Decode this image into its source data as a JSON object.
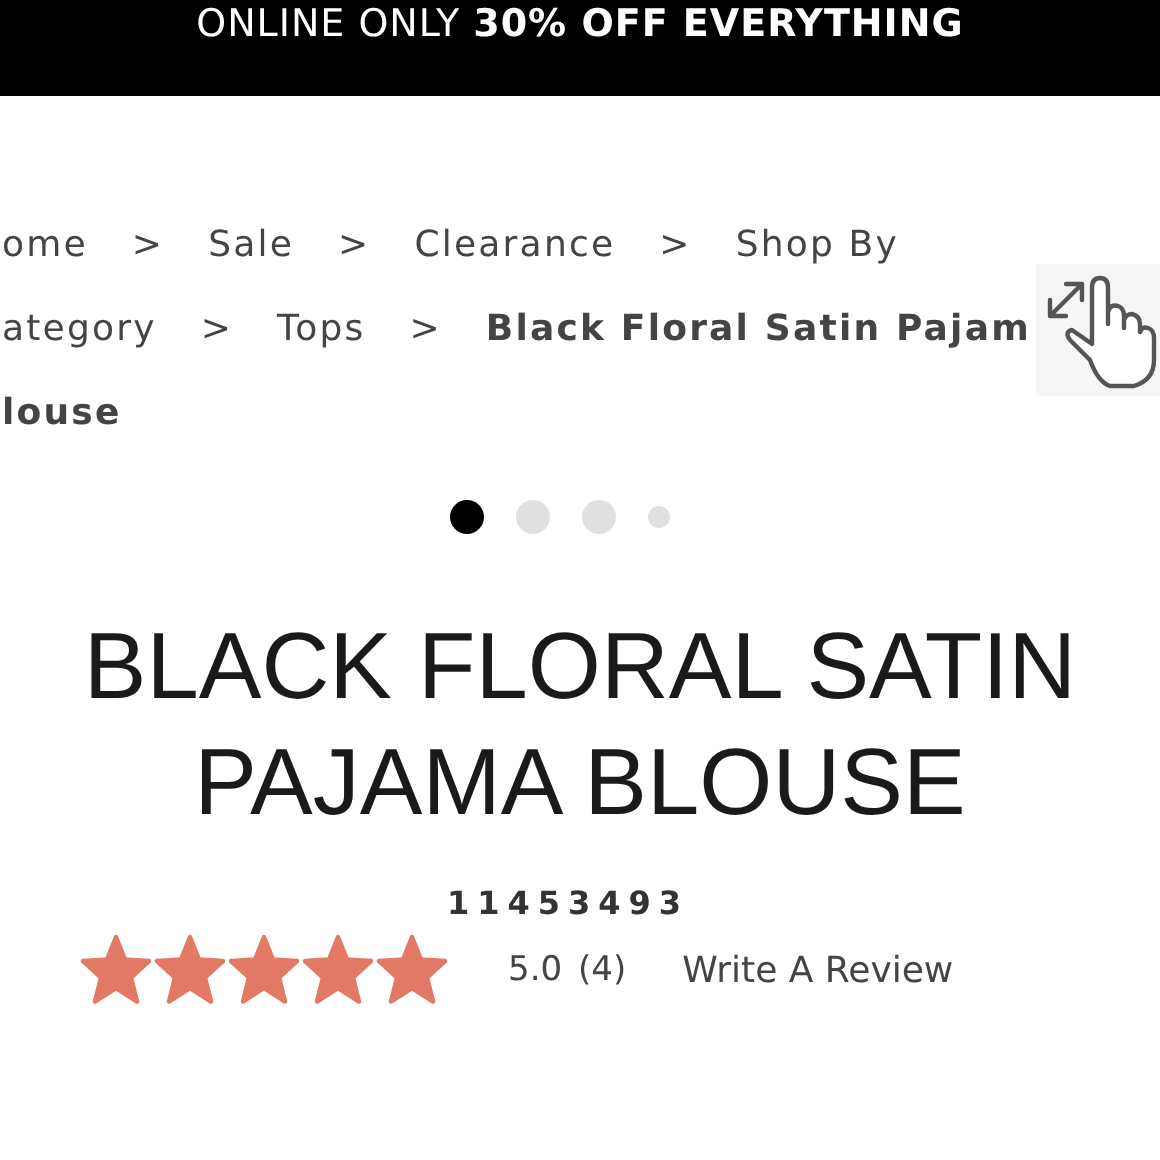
{
  "promo_banner": {
    "text": "ONLINE ONLY **30% OFF EVERYTHING**"
  },
  "breadcrumb": {
    "lines": [
      [
        {
          "kind": "link",
          "text": "ome"
        },
        {
          "kind": "separator",
          "text": ">"
        },
        {
          "kind": "link",
          "text": "Sale"
        },
        {
          "kind": "separator",
          "text": ">"
        },
        {
          "kind": "link",
          "text": "Clearance"
        },
        {
          "kind": "separator",
          "text": ">"
        },
        {
          "kind": "link",
          "text": "Shop By"
        }
      ],
      [
        {
          "kind": "link",
          "text": "ategory"
        },
        {
          "kind": "separator",
          "text": ">"
        },
        {
          "kind": "link",
          "text": "Tops"
        },
        {
          "kind": "separator",
          "text": ">"
        },
        {
          "kind": "current",
          "text": "Black Floral Satin Pajam"
        }
      ],
      [
        {
          "kind": "current",
          "text": "louse"
        }
      ]
    ]
  },
  "carousel_dots": [
    {
      "selected": true
    },
    {
      "selected": false
    },
    {
      "selected": false
    },
    {
      "selected": false
    }
  ],
  "product": {
    "title_lines": [
      "BLACK FLORAL SATIN",
      "PAJAMA BLOUSE"
    ],
    "sku": "11453493",
    "rating": {
      "stars": 5,
      "score": "5.0",
      "count": "(4)"
    },
    "review_link": "Write A Review"
  }
}
